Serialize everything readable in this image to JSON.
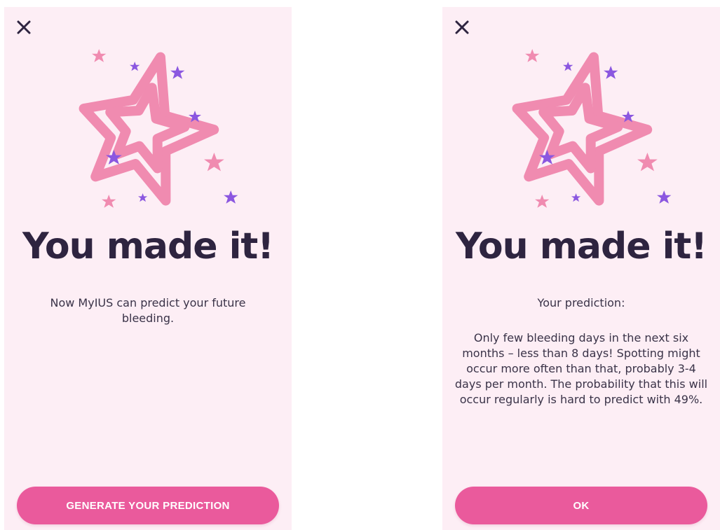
{
  "colors": {
    "background": "#fdeef5",
    "accent": "#ea5a9c",
    "star_pink": "#f08bb0",
    "star_purple": "#8b57e0",
    "heading": "#2e2440"
  },
  "screen_left": {
    "close_icon": "close-icon",
    "illustration_icon": "stars-illustration-icon",
    "headline": "You made it!",
    "body": "Now MyIUS can predict your future bleeding.",
    "button_label": "GENERATE YOUR PREDICTION"
  },
  "screen_right": {
    "close_icon": "close-icon",
    "illustration_icon": "stars-illustration-icon",
    "headline": "You made it!",
    "intro": "Your prediction:",
    "prediction": "Only few bleeding days in the next six months – less than 8 days! Spotting might occur more often than that, probably 3-4 days per month. The probability that this will occur regularly is hard to predict with 49%.",
    "button_label": "OK"
  }
}
